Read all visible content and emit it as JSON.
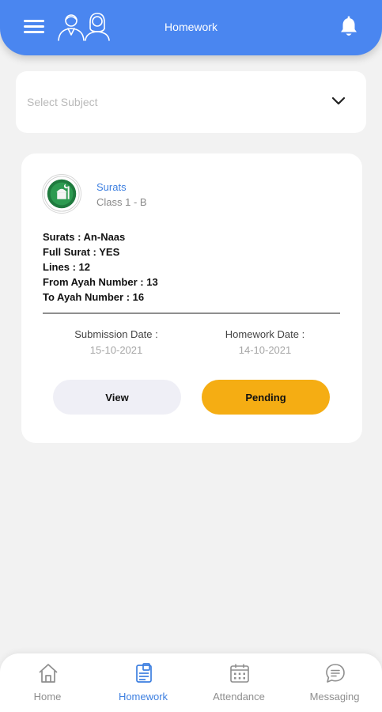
{
  "header": {
    "title": "Homework",
    "menu_icon": "hamburger-menu-icon",
    "avatar_icon": "parents-icon",
    "bell_icon": "bell-icon",
    "color": "#4a86f0"
  },
  "filter": {
    "placeholder": "Select Subject",
    "chevron_icon": "chevron-down-icon"
  },
  "homework_card": {
    "logo_icon": "school-logo-icon",
    "subject": "Surats",
    "class": "Class 1 - B",
    "details": [
      "Surats : An-Naas",
      "Full Surat : YES",
      "Lines : 12",
      "From Ayah Number : 13",
      "To Ayah Number : 16"
    ],
    "submission_date_label": "Submission Date :",
    "submission_date": "15-10-2021",
    "homework_date_label": "Homework Date :",
    "homework_date": "14-10-2021",
    "view_label": "View",
    "status_label": "Pending",
    "status_color": "#f5ad13"
  },
  "bottom_nav": {
    "items": [
      {
        "label": "Home",
        "icon": "home-icon"
      },
      {
        "label": "Homework",
        "icon": "homework-icon",
        "active": true
      },
      {
        "label": "Attendance",
        "icon": "calendar-icon"
      },
      {
        "label": "Messaging",
        "icon": "chat-icon"
      }
    ],
    "active_color": "#3d7fe0"
  }
}
